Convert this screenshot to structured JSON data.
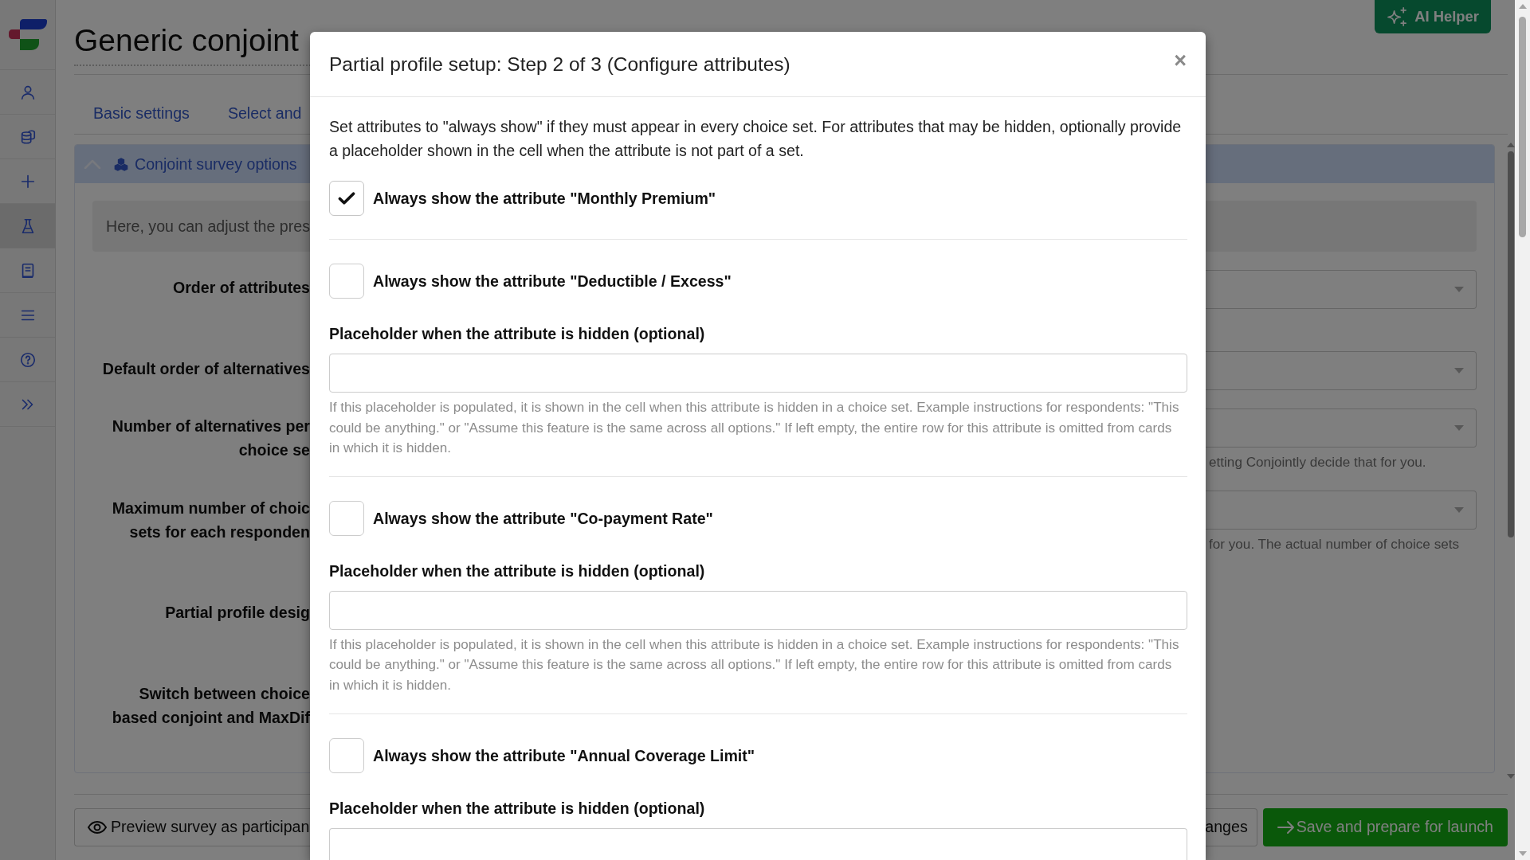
{
  "sidebar": {
    "items": [
      {
        "selected": false
      },
      {
        "selected": false
      },
      {
        "selected": false
      },
      {
        "selected": true
      },
      {
        "selected": false
      },
      {
        "selected": false
      },
      {
        "selected": false
      },
      {
        "selected": false
      }
    ]
  },
  "header": {
    "title": "Generic conjoint",
    "ai_helper": "AI Helper"
  },
  "tabs": [
    {
      "label": "Basic settings",
      "selected": false
    },
    {
      "label": "Select and",
      "selected": false
    }
  ],
  "panel": {
    "title": "Conjoint survey options",
    "expanded": true,
    "info": "Here, you can adjust the pres",
    "rows": [
      {
        "label": [
          "Order of attributes"
        ],
        "kind": "select"
      },
      {
        "label": [
          "Default order of alternatives"
        ],
        "kind": "select"
      },
      {
        "label": [
          "Number of alternatives per",
          "choice se"
        ],
        "kind": "select",
        "help": "etting Conjointly decide that for you."
      },
      {
        "label": [
          "Maximum number of choic",
          "sets for each responden"
        ],
        "kind": "select",
        "help": "for you. The actual number of choice sets"
      },
      {
        "label": [
          "Partial profile desig"
        ],
        "kind": "plain"
      },
      {
        "label": [
          "Switch between choice",
          "based conjoint and MaxDif"
        ],
        "kind": "plain"
      }
    ]
  },
  "footer": {
    "preview": "Preview survey as participan",
    "changes": "anges",
    "save": "Save and prepare for launch"
  },
  "modal": {
    "title": "Partial profile setup: Step 2 of 3 (Configure attributes)",
    "close": "×",
    "intro": "Set attributes to \"always show\" if they must appear in every choice set. For attributes that may be hidden, optionally provide a placeholder shown in the cell when the attribute is not part of a set.",
    "attributes": [
      {
        "label": "Always show the attribute \"Monthly Premium\"",
        "checked": true
      },
      {
        "label": "Always show the attribute \"Deductible / Excess\"",
        "checked": false,
        "placeholder_label": "Placeholder when the attribute is hidden (optional)",
        "help": "If this placeholder is populated, it is shown in the cell when this attribute is hidden in a choice set. Example instructions for respondents: \"This could be anything.\" or \"Assume this feature is the same across all options.\" If left empty, the entire row for this attribute is omitted from cards in which it is hidden."
      },
      {
        "label": "Always show the attribute \"Co-payment Rate\"",
        "checked": false,
        "placeholder_label": "Placeholder when the attribute is hidden (optional)",
        "help": "If this placeholder is populated, it is shown in the cell when this attribute is hidden in a choice set. Example instructions for respondents: \"This could be anything.\" or \"Assume this feature is the same across all options.\" If left empty, the entire row for this attribute is omitted from cards in which it is hidden."
      },
      {
        "label": "Always show the attribute \"Annual Coverage Limit\"",
        "checked": false,
        "placeholder_label": "Placeholder when the attribute is hidden (optional)"
      }
    ]
  }
}
